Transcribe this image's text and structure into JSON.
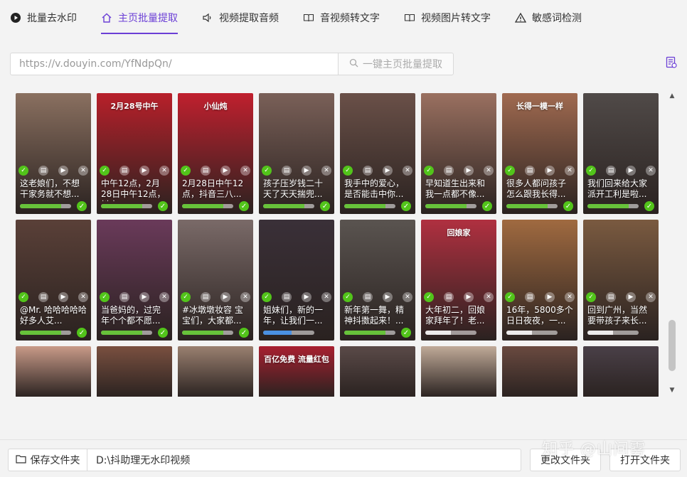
{
  "tabs": [
    {
      "label": "批量去水印",
      "icon": "play-circle-icon"
    },
    {
      "label": "主页批量提取",
      "icon": "home-icon",
      "active": true
    },
    {
      "label": "视频提取音频",
      "icon": "speaker-icon"
    },
    {
      "label": "音视频转文字",
      "icon": "book-icon"
    },
    {
      "label": "视频图片转文字",
      "icon": "book-icon"
    },
    {
      "label": "敏感词检测",
      "icon": "warning-icon"
    }
  ],
  "url_input": {
    "value": "https://v.douyin.com/YfNdpQn/"
  },
  "extract_button": {
    "label": "一键主页批量提取"
  },
  "videos_row1": [
    {
      "caption": "这老娘们，不想干家务就不想...",
      "progress": 0.8,
      "done": true,
      "bg": "#8a7060"
    },
    {
      "caption": "中午12点，2月28日中午12点，抖音...",
      "progress": 0.8,
      "done": true,
      "bg": "#b8202a",
      "overlay": "2月28号中午"
    },
    {
      "caption": "2月28日中午12点，抖音三八...",
      "progress": 0.8,
      "done": true,
      "bg": "#c0202e",
      "overlay": "小仙炖"
    },
    {
      "caption": "孩子压岁钱二十天了天天揣兜...",
      "progress": 0.8,
      "done": true,
      "bg": "#7a6058"
    },
    {
      "caption": "我手中的爱心，是否能击中你...",
      "progress": 0.8,
      "done": true,
      "bg": "#6a5048"
    },
    {
      "caption": "早知道生出来和我一点都不像...",
      "progress": 0.8,
      "done": true,
      "bg": "#9a7060"
    },
    {
      "caption": "很多人都问孩子怎么跟我长得...",
      "progress": 0.8,
      "done": true,
      "bg": "#a06a50",
      "overlay": "长得一模一样"
    },
    {
      "caption": "我们回来给大家派开工利是啦...",
      "progress": 0.8,
      "done": true,
      "bg": "#504a48"
    }
  ],
  "videos_row2": [
    {
      "caption": "@Mr. 哈哈哈哈哈好多人艾...",
      "progress": 0.8,
      "done": true,
      "bg": "#5a4038"
    },
    {
      "caption": "当爸妈的，过完年个个都不愿...",
      "progress": 0.8,
      "done": true,
      "bg": "#6a3a5a"
    },
    {
      "caption": "#冰墩墩妆容 宝宝们，大家都...",
      "progress": 0.8,
      "done": true,
      "bg": "#7a6a68"
    },
    {
      "caption": "姐妹们，新的一年，让我们一...",
      "progress": 0.55,
      "done": false,
      "bg": "#3a3038"
    },
    {
      "caption": "新年第一舞，精神抖擞起来！...",
      "progress": 0.8,
      "done": true,
      "bg": "#5a5450"
    },
    {
      "caption": "大年初二，回娘家拜年了！老...",
      "progress": 0.5,
      "done": false,
      "bg": "#b03040",
      "overlay": "回娘家"
    },
    {
      "caption": "16年，5800多个日日夜夜，一...",
      "progress": 0.5,
      "done": false,
      "bg": "#a06a40"
    },
    {
      "caption": "回到广州，当然要带孩子来长...",
      "progress": 0.5,
      "done": false,
      "bg": "#7a5a40"
    }
  ],
  "videos_row3": [
    {
      "bg": "#c89a88"
    },
    {
      "bg": "#7a5040"
    },
    {
      "bg": "#9a8070"
    },
    {
      "bg": "#a82030",
      "overlay": "百亿免费 流量红包"
    },
    {
      "bg": "#5a4a48"
    },
    {
      "bg": "#c0aa98"
    },
    {
      "bg": "#6a4a40"
    },
    {
      "bg": "#4a4048"
    }
  ],
  "save_folder_button": {
    "label": "保存文件夹"
  },
  "save_path": {
    "value": "D:\\抖助理无水印视频"
  },
  "change_folder_button": {
    "label": "更改文件夹"
  },
  "open_folder_button": {
    "label": "打开文件夹"
  },
  "watermark": "知乎 @山间雾"
}
